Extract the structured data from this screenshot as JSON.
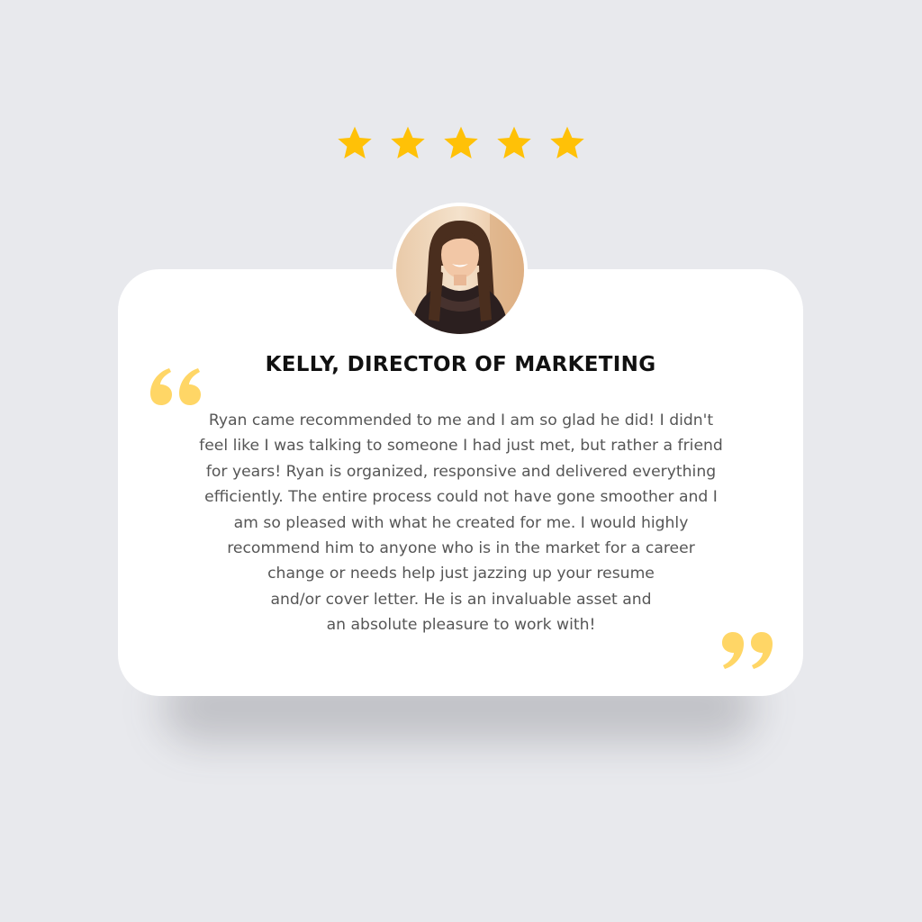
{
  "rating": {
    "stars": 5,
    "color": "#ffc107"
  },
  "avatar": {
    "icon": "person-photo"
  },
  "reviewer": {
    "name": "KELLY, DIRECTOR OF MARKETING"
  },
  "quote_marks": {
    "color": "#ffd666",
    "open_icon": "open-quote-icon",
    "close_icon": "close-quote-icon"
  },
  "testimonial": {
    "lines": [
      "Ryan came recommended to me and I am so glad he did! I didn't",
      "feel like I was talking to someone I had just met, but rather a friend",
      "for years! Ryan is organized, responsive and delivered everything",
      "efficiently. The entire process could not have gone smoother and I",
      "am so pleased with what he created for me. I would highly",
      "recommend him to anyone who is in the market for a career",
      "change or needs help just jazzing up your resume",
      "and/or cover letter. He is an invaluable asset and",
      "an absolute pleasure to work with!"
    ]
  }
}
